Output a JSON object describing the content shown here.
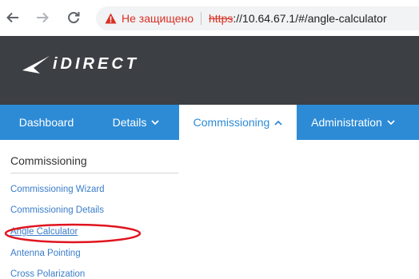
{
  "browser": {
    "not_secure_label": "Не защищено",
    "url_scheme": "https",
    "url_rest": "://10.64.67.1/#/angle-calculator",
    "icons": [
      "back-arrow-icon",
      "forward-arrow-icon",
      "reload-icon",
      "warning-icon"
    ]
  },
  "header": {
    "logo_text": "iDIRECT"
  },
  "navbar": {
    "items": [
      {
        "label": "Dashboard",
        "has_chevron": false
      },
      {
        "label": "Details",
        "has_chevron": true
      },
      {
        "label": "Commissioning",
        "has_chevron": true,
        "active": true
      },
      {
        "label": "Administration",
        "has_chevron": true
      }
    ]
  },
  "sidebar": {
    "title": "Commissioning",
    "items": [
      {
        "label": "Commissioning Wizard"
      },
      {
        "label": "Commissioning Details"
      },
      {
        "label": "Angle Calculator",
        "current": true
      },
      {
        "label": "Antenna Pointing"
      },
      {
        "label": "Cross Polarization"
      }
    ]
  },
  "colors": {
    "header_bg": "#3c3f44",
    "nav_bg": "#2d8bd6",
    "link": "#3a7dc9",
    "annotation_red": "#e0141e",
    "warning_red": "#d93025"
  }
}
